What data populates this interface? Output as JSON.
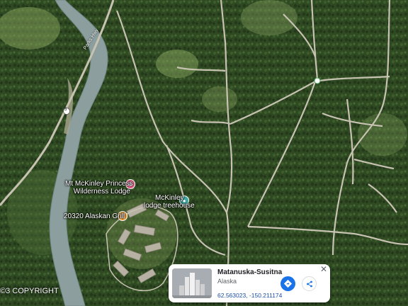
{
  "map": {
    "road_label": "Parks Hwy",
    "route_number": "3",
    "copyright": "©3 COPYRIGHT",
    "colors": {
      "forest": "#2f4a23",
      "clearing": "#7f9a58",
      "river": "#8c9f9e",
      "road": "#c7c2b2",
      "pink_pin": "#e8608a",
      "orange_pin": "#f29a2e",
      "teal_pin": "#3fa7a0"
    }
  },
  "places": [
    {
      "name_line1": "Mt McKinley Princess",
      "name_line2": "Wilderness Lodge",
      "icon": "hotel-bed-icon"
    },
    {
      "name_line1": "McKinley",
      "name_line2": "lodge treehouse",
      "icon": "camera-icon"
    },
    {
      "name_line1": "20320 Alaskan Grill",
      "icon": "restaurant-icon"
    }
  ],
  "info_card": {
    "title": "Matanuska-Susitna",
    "subtitle": "Alaska",
    "coordinates": "62.563023, -150.211174",
    "close_symbol": "✕"
  }
}
